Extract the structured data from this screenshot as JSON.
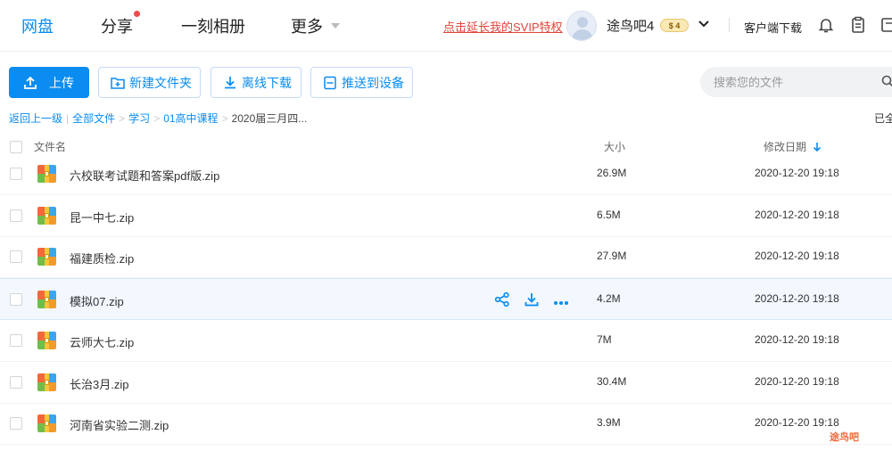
{
  "header": {
    "nav": [
      {
        "label": "网盘",
        "active": true
      },
      {
        "label": "分享",
        "active": false
      },
      {
        "label": "一刻相册",
        "active": false
      },
      {
        "label": "更多",
        "active": false
      }
    ],
    "promo": "点击延长我的SVIP特权",
    "username": "途鸟吧4",
    "vip_badge": "$ 4",
    "client_download": "客户端下载",
    "icons": [
      "bell-icon",
      "clipboard-icon",
      "grid-icon"
    ]
  },
  "toolbar": {
    "upload": "上传",
    "new_folder": "新建文件夹",
    "offline_download": "离线下载",
    "push_device": "推送到设备",
    "search_placeholder": "搜索您的文件"
  },
  "breadcrumb": {
    "back": "返回上一级",
    "items": [
      "全部文件",
      "学习",
      "01高中课程"
    ],
    "current": "2020届三月四...",
    "loaded_text": "已全"
  },
  "table": {
    "columns": {
      "name": "文件名",
      "size": "大小",
      "modified": "修改日期"
    },
    "sort_arrow": "descending",
    "rows": [
      {
        "name": "六校联考试题和答案pdf版.zip",
        "size": "26.9M",
        "date": "2020-12-20 19:18"
      },
      {
        "name": "昆一中七.zip",
        "size": "6.5M",
        "date": "2020-12-20 19:18"
      },
      {
        "name": "福建质检.zip",
        "size": "27.9M",
        "date": "2020-12-20 19:18"
      },
      {
        "name": "模拟07.zip",
        "size": "4.2M",
        "date": "2020-12-20 19:18",
        "hover": true
      },
      {
        "name": "云师大七.zip",
        "size": "7M",
        "date": "2020-12-20 19:18"
      },
      {
        "name": "长治3月.zip",
        "size": "30.4M",
        "date": "2020-12-20 19:18"
      },
      {
        "name": "河南省实验二测.zip",
        "size": "3.9M",
        "date": "2020-12-20 19:18"
      }
    ],
    "row_actions": [
      "share-icon",
      "download-icon",
      "more-icon"
    ]
  },
  "colors": {
    "accent": "#0a8cf0",
    "promo": "#e0443a"
  },
  "watermark": "途鸟吧"
}
